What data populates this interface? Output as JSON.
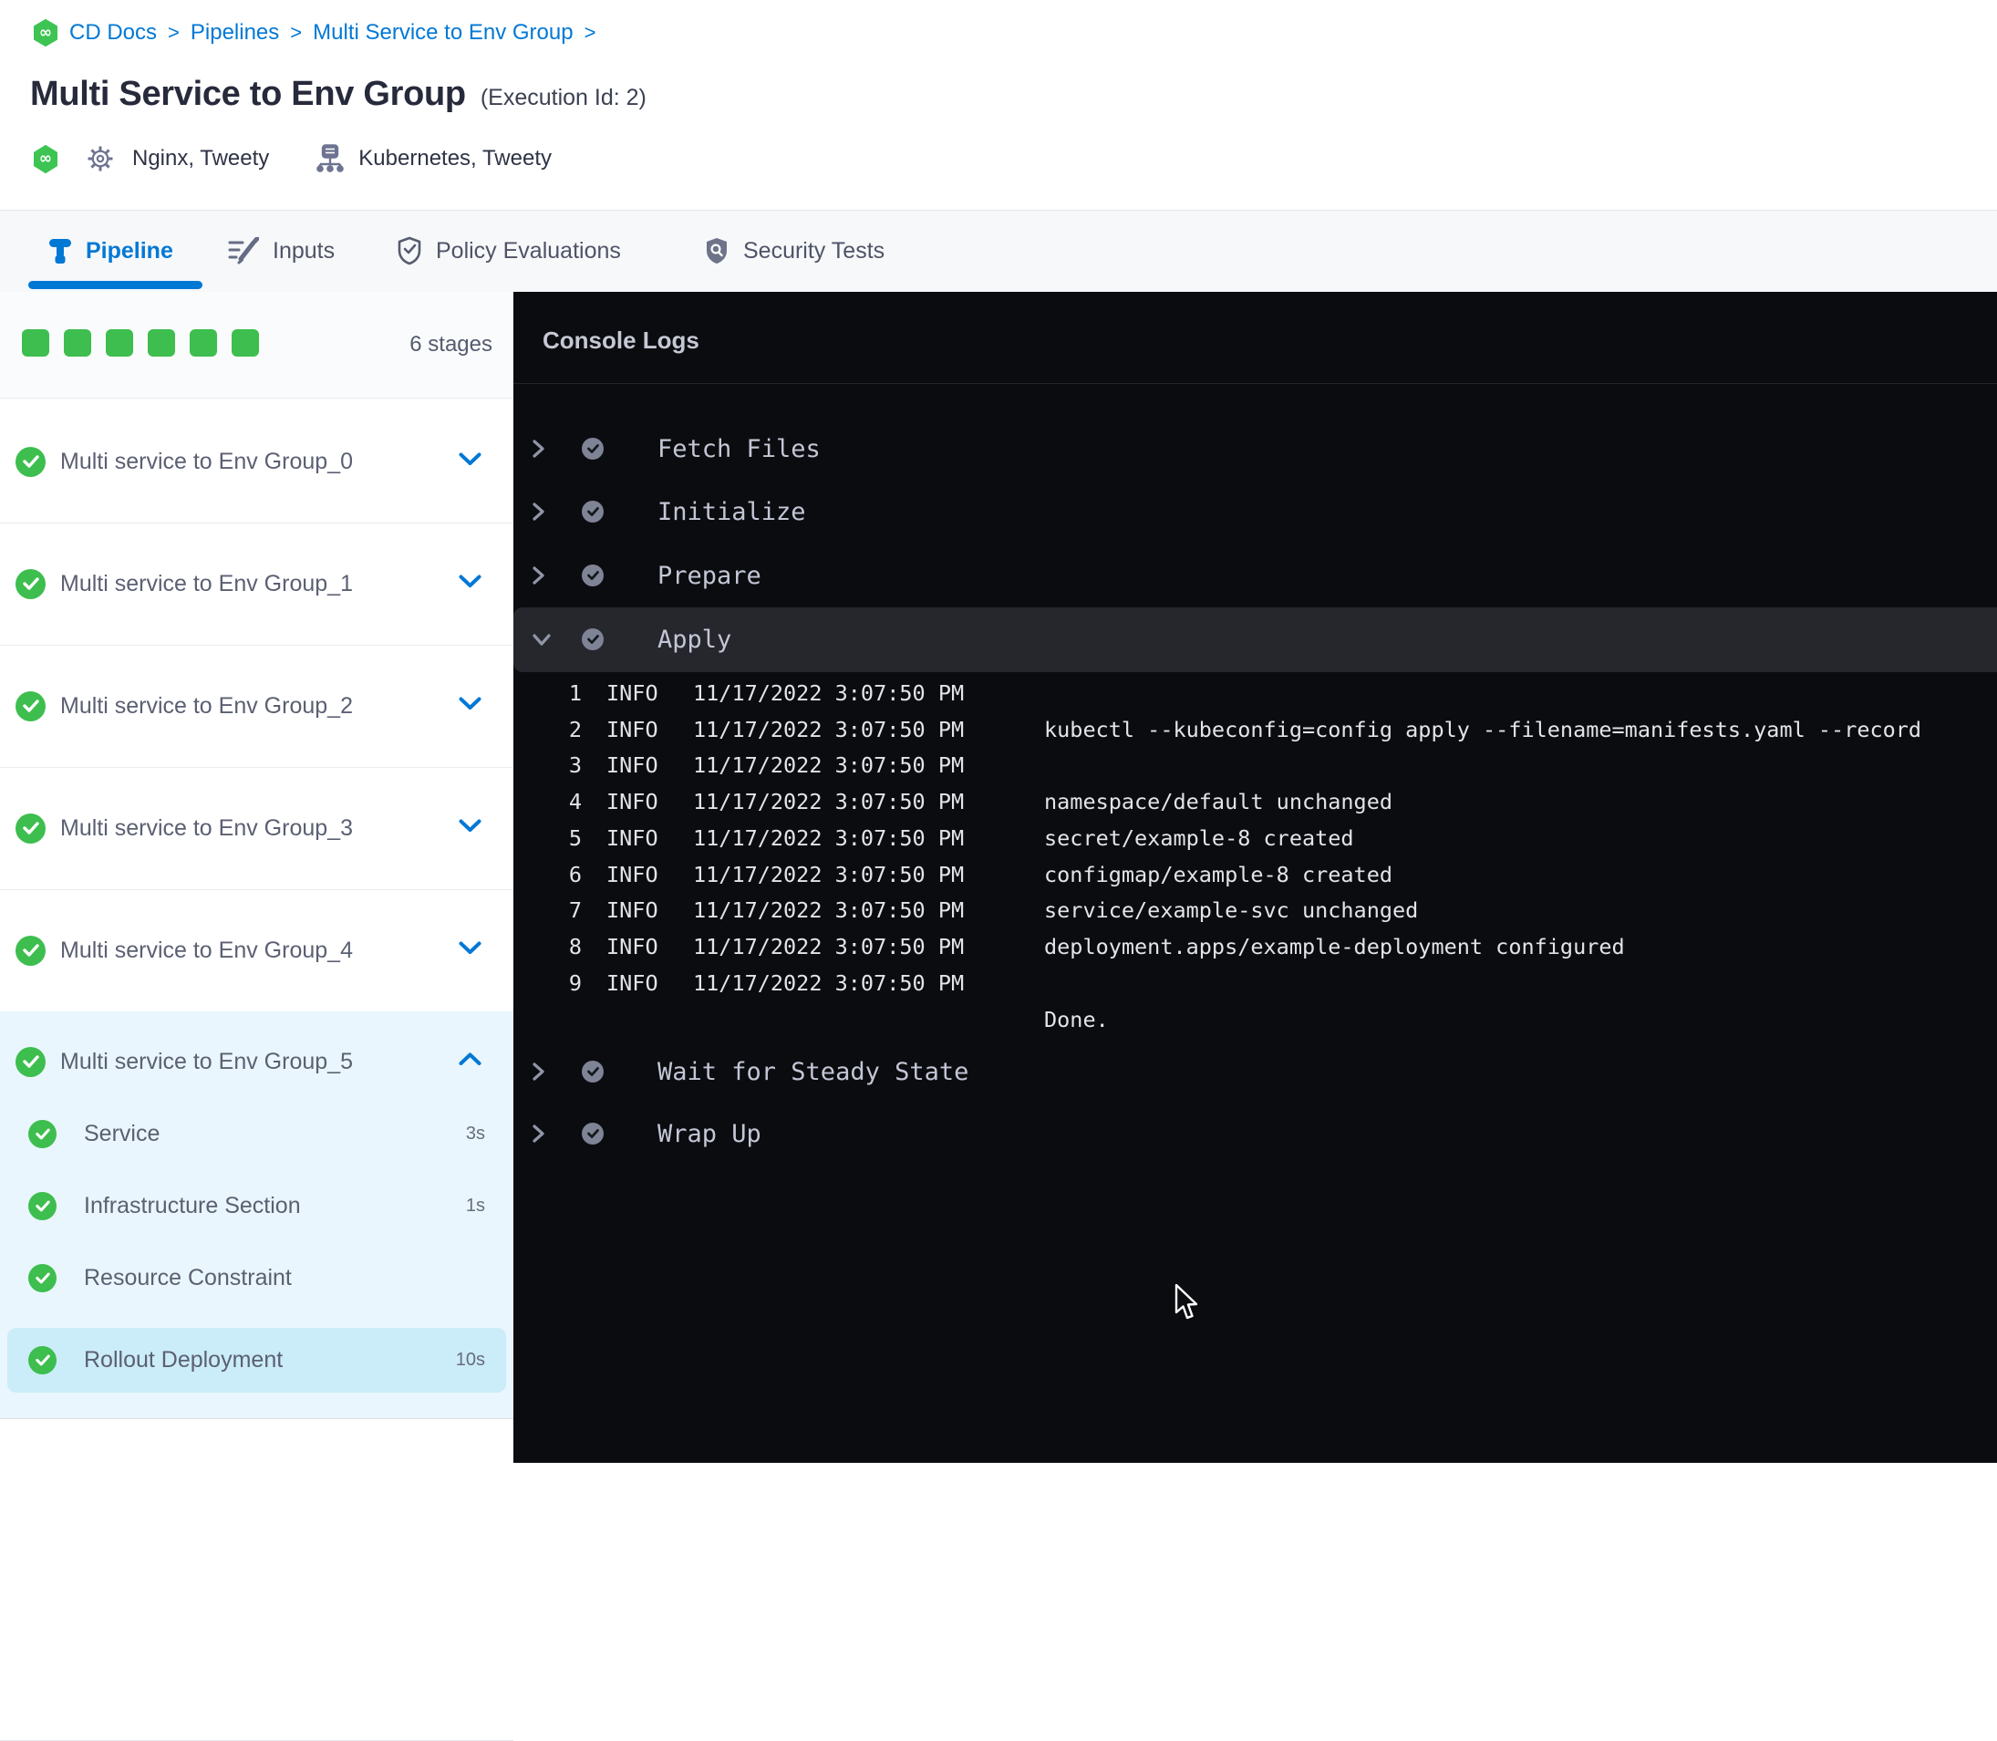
{
  "breadcrumb": {
    "separator": ">",
    "items": [
      {
        "label": "CD Docs"
      },
      {
        "label": "Pipelines"
      },
      {
        "label": "Multi Service to Env Group"
      }
    ]
  },
  "header": {
    "title": "Multi Service to Env Group",
    "execution_id": "(Execution Id: 2)",
    "services_label": "Nginx, Tweety",
    "environments_label": "Kubernetes, Tweety"
  },
  "tabs": [
    {
      "label": "Pipeline",
      "active": true
    },
    {
      "label": "Inputs",
      "active": false
    },
    {
      "label": "Policy Evaluations",
      "active": false
    },
    {
      "label": "Security Tests",
      "active": false
    }
  ],
  "stages_panel": {
    "stage_count_label": "6 stages",
    "stages": [
      {
        "label": "Multi service to Env Group_0"
      },
      {
        "label": "Multi service to Env Group_1"
      },
      {
        "label": "Multi service to Env Group_2"
      },
      {
        "label": "Multi service to Env Group_3"
      },
      {
        "label": "Multi service to Env Group_4"
      },
      {
        "label": "Multi service to Env Group_5"
      }
    ],
    "expanded_stage_steps": [
      {
        "label": "Service",
        "duration": "3s"
      },
      {
        "label": "Infrastructure Section",
        "duration": "1s"
      },
      {
        "label": "Resource Constraint",
        "duration": ""
      },
      {
        "label": "Rollout Deployment",
        "duration": "10s",
        "selected": true
      }
    ]
  },
  "console": {
    "title": "Console Logs",
    "steps": [
      {
        "label": "Fetch Files",
        "state": "collapsed"
      },
      {
        "label": "Initialize",
        "state": "collapsed"
      },
      {
        "label": "Prepare",
        "state": "collapsed"
      },
      {
        "label": "Apply",
        "state": "expanded"
      },
      {
        "label": "Wait for Steady State",
        "state": "collapsed"
      },
      {
        "label": "Wrap Up",
        "state": "collapsed"
      }
    ],
    "log_lines": [
      {
        "num": "1",
        "level": "INFO",
        "time": "11/17/2022 3:07:50 PM",
        "message": ""
      },
      {
        "num": "2",
        "level": "INFO",
        "time": "11/17/2022 3:07:50 PM",
        "message": "kubectl --kubeconfig=config apply --filename=manifests.yaml --record"
      },
      {
        "num": "3",
        "level": "INFO",
        "time": "11/17/2022 3:07:50 PM",
        "message": ""
      },
      {
        "num": "4",
        "level": "INFO",
        "time": "11/17/2022 3:07:50 PM",
        "message": "namespace/default unchanged"
      },
      {
        "num": "5",
        "level": "INFO",
        "time": "11/17/2022 3:07:50 PM",
        "message": "secret/example-8 created"
      },
      {
        "num": "6",
        "level": "INFO",
        "time": "11/17/2022 3:07:50 PM",
        "message": "configmap/example-8 created"
      },
      {
        "num": "7",
        "level": "INFO",
        "time": "11/17/2022 3:07:50 PM",
        "message": "service/example-svc unchanged"
      },
      {
        "num": "8",
        "level": "INFO",
        "time": "11/17/2022 3:07:50 PM",
        "message": "deployment.apps/example-deployment configured"
      },
      {
        "num": "9",
        "level": "INFO",
        "time": "11/17/2022 3:07:50 PM",
        "message": ""
      }
    ],
    "done_label": "Done."
  },
  "icons": {
    "harness-logo": "green hexagon with white infinity",
    "gear-icon": "service settings gear",
    "environment-icon": "server with network nodes",
    "pipeline-icon": "pipeline plumb",
    "inputs-icon": "lines with pencil",
    "policy-icon": "shield with check",
    "security-icon": "shield with magnifier",
    "check-circle-icon": "success check",
    "infinity_glyph": "∞"
  },
  "colors": {
    "accent_blue": "#0278d5",
    "success_green": "#3dbe4e",
    "console_bg": "#0b0c0f",
    "selected_row": "#cbecf9",
    "expanded_section": "#e9f6fd"
  }
}
